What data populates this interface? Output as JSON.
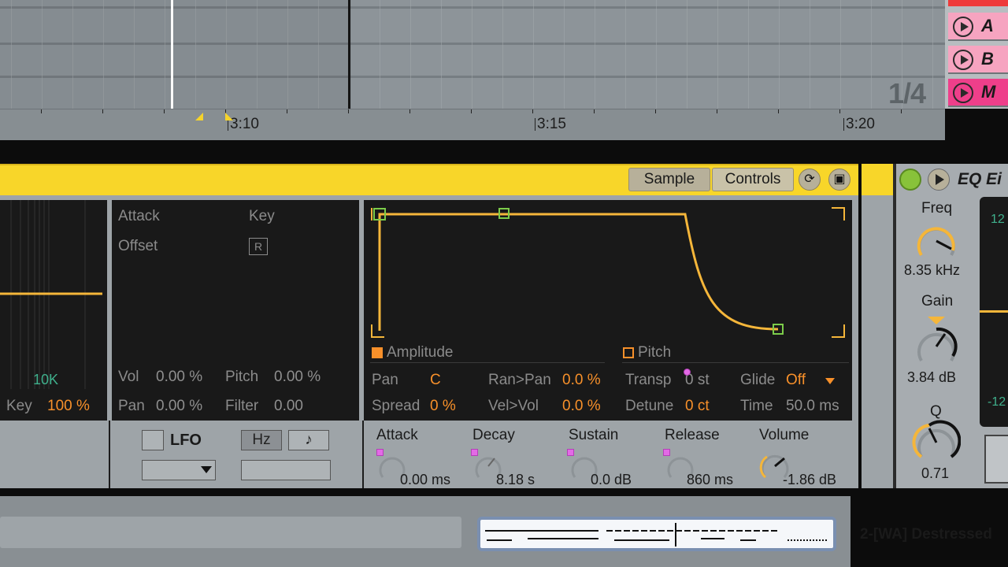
{
  "arrangement": {
    "ruler_labels": [
      "3:10",
      "3:15",
      "3:20"
    ],
    "quantization": "1/4"
  },
  "scenes": [
    {
      "label": "A",
      "active": false
    },
    {
      "label": "B",
      "active": false
    },
    {
      "label": "M",
      "active": true
    }
  ],
  "sampler": {
    "tabs": {
      "sample": "Sample",
      "controls": "Controls"
    },
    "filter_panel": {
      "freq_label": "10K",
      "key_label": "Key",
      "key_value": "100 %"
    },
    "mod_panel": {
      "attack_label": "Attack",
      "key_label": "Key",
      "offset_label": "Offset",
      "retrig_label": "R",
      "vol_label": "Vol",
      "vol_value": "0.00 %",
      "pitch_label": "Pitch",
      "pitch_value": "0.00 %",
      "pan_label": "Pan",
      "pan_value": "0.00 %",
      "filter_label": "Filter",
      "filter_value": "0.00"
    },
    "envelope": {
      "amplitude_label": "Amplitude",
      "pitch_label": "Pitch"
    },
    "amp_params": {
      "pan_label": "Pan",
      "pan_value": "C",
      "ranpan_label": "Ran>Pan",
      "ranpan_value": "0.0 %",
      "spread_label": "Spread",
      "spread_value": "0 %",
      "velvol_label": "Vel>Vol",
      "velvol_value": "0.0 %"
    },
    "pitch_params": {
      "transp_label": "Transp",
      "transp_value": "0 st",
      "glide_label": "Glide",
      "glide_value": "Off",
      "detune_label": "Detune",
      "detune_value": "0 ct",
      "time_label": "Time",
      "time_value": "50.0 ms"
    },
    "lfo": {
      "label": "LFO",
      "hz_label": "Hz",
      "note_label": "♪"
    },
    "env_knobs": [
      {
        "label": "Attack",
        "value": "0.00 ms"
      },
      {
        "label": "Decay",
        "value": "8.18 s"
      },
      {
        "label": "Sustain",
        "value": "0.0 dB"
      },
      {
        "label": "Release",
        "value": "860 ms"
      },
      {
        "label": "Volume",
        "value": "-1.86 dB"
      }
    ]
  },
  "eq": {
    "title": "EQ Ei",
    "freq_label": "Freq",
    "freq_value": "8.35 kHz",
    "gain_label": "Gain",
    "gain_value": "3.84 dB",
    "q_label": "Q",
    "q_value": "0.71",
    "scale_labels": [
      "12",
      "-12"
    ]
  },
  "clip": {
    "name": "2-[WA] Destressed"
  },
  "colors": {
    "accent": "#f7902a",
    "title_bar": "#f8d629",
    "envelope": "#f5b63a",
    "scene_active": "#ee3f8a"
  }
}
